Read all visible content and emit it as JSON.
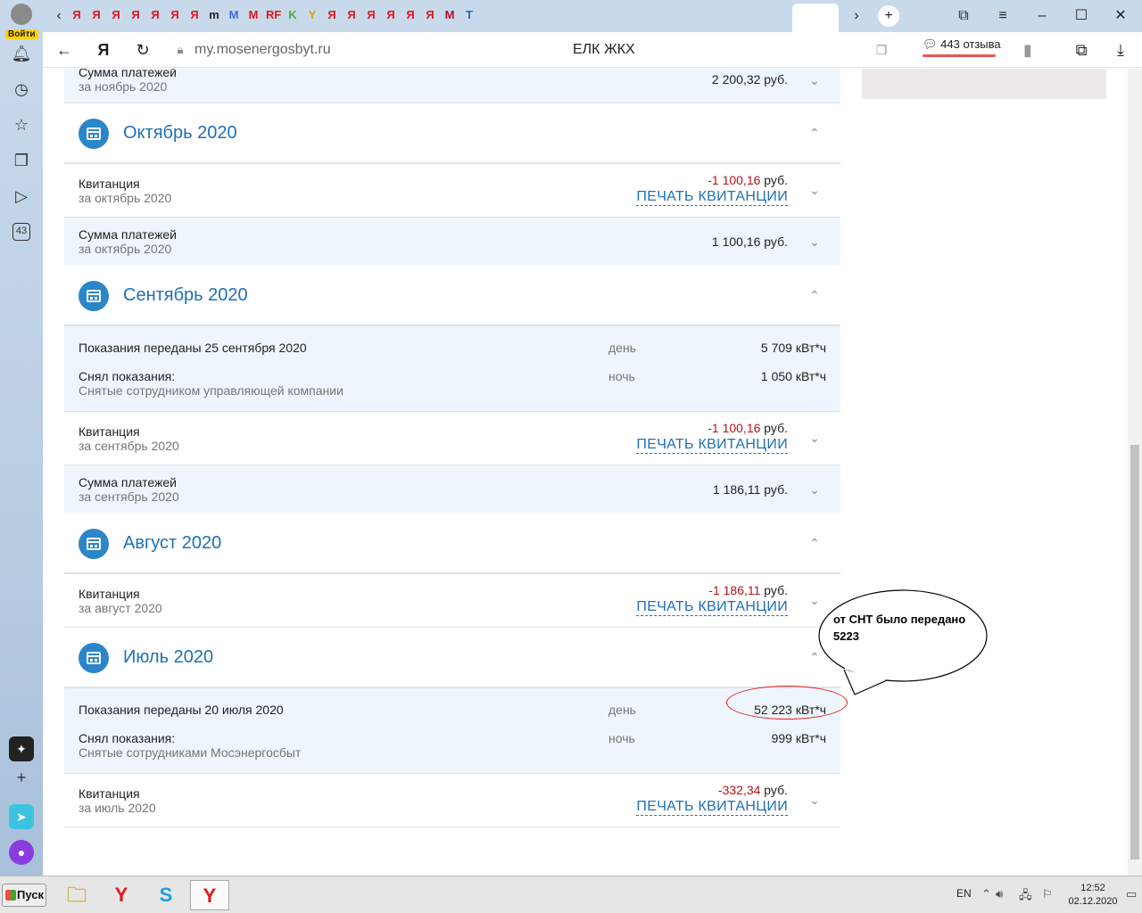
{
  "browser": {
    "login_label": "Войти",
    "url": "my.mosenergosbyt.ru",
    "page_title": "ЕЛК ЖКХ",
    "reviews_label": "443 отзыва",
    "rail_counter": "43",
    "tab_marks": [
      "Я",
      "Я",
      "Я",
      "Я",
      "Я",
      "Я",
      "Я",
      "m",
      "M",
      "M",
      "RF",
      "K",
      "Y",
      "Я",
      "Я",
      "Я",
      "Я",
      "Я",
      "Я",
      "M",
      "T"
    ]
  },
  "content": {
    "top_payment": {
      "title": "Сумма платежей",
      "period": "за ноябрь 2020",
      "amount": "2 200,32 руб."
    },
    "months": [
      {
        "name": "Октябрь 2020"
      },
      {
        "name": "Сентябрь 2020"
      },
      {
        "name": "Август 2020"
      },
      {
        "name": "Июль 2020"
      }
    ],
    "oct": {
      "receipt": {
        "title": "Квитанция",
        "period": "за октябрь 2020",
        "amount": "-1 100,16",
        "currency": " руб.",
        "print": "ПЕЧАТЬ КВИТАНЦИИ"
      },
      "payment": {
        "title": "Сумма платежей",
        "period": "за октябрь 2020",
        "amount": "1 100,16 руб."
      }
    },
    "sep": {
      "readings": {
        "title": "Показания переданы 25 сентября 2020",
        "day_label": "день",
        "day_value": "5 709 кВт*ч",
        "taken_title": "Снял показания:",
        "taken_by": "Снятые сотрудником управляющей компании",
        "night_label": "ночь",
        "night_value": "1 050 кВт*ч"
      },
      "receipt": {
        "title": "Квитанция",
        "period": "за сентябрь 2020",
        "amount": "-1 100,16",
        "currency": " руб.",
        "print": "ПЕЧАТЬ КВИТАНЦИИ"
      },
      "payment": {
        "title": "Сумма платежей",
        "period": "за сентябрь 2020",
        "amount": "1 186,11 руб."
      }
    },
    "aug": {
      "receipt": {
        "title": "Квитанция",
        "period": "за август 2020",
        "amount": "-1 186,11",
        "currency": " руб.",
        "print": "ПЕЧАТЬ КВИТАНЦИИ"
      }
    },
    "jul": {
      "readings": {
        "title": "Показания переданы 20 июля 2020",
        "day_label": "день",
        "day_value": "52 223 кВт*ч",
        "taken_title": "Снял показания:",
        "taken_by": "Снятые сотрудниками Мосэнергосбыт",
        "night_label": "ночь",
        "night_value": "999 кВт*ч"
      },
      "receipt": {
        "title": "Квитанция",
        "period": "за июль 2020",
        "amount": "-332,34",
        "currency": " руб.",
        "print": "ПЕЧАТЬ КВИТАНЦИИ"
      }
    },
    "annotation": {
      "line1": "от СНТ было передано",
      "line2": "5223"
    }
  },
  "taskbar": {
    "start_label": "Пуск",
    "lang": "EN",
    "time": "12:52",
    "date": "02.12.2020"
  },
  "colors": {
    "accent": "#1e6fb8",
    "negative": "#b5121b",
    "row_bg": "#eef5fd",
    "annotation": "#e01a1a"
  }
}
